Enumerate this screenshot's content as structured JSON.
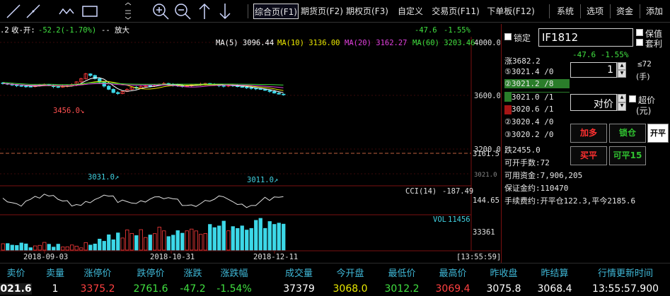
{
  "toolbar": {
    "tabs": [
      {
        "label": "综合页(F1)",
        "active": true
      },
      {
        "label": "期货页(F2)",
        "active": false
      },
      {
        "label": "期权页(F3)",
        "active": false
      },
      {
        "label": "自定义",
        "active": false
      },
      {
        "label": "交易页(F11)",
        "active": false
      },
      {
        "label": "下单板(F12)",
        "active": false
      },
      {
        "label": "系统",
        "active": false
      },
      {
        "label": "选项",
        "active": false
      },
      {
        "label": "资金",
        "active": false
      },
      {
        "label": "添加",
        "active": false
      }
    ]
  },
  "chart_header": {
    "left_prefix": ".2",
    "label": "收-开:",
    "change": "-52.2(-1.70%)",
    "zoom": "-- 放大",
    "right_change": "-47.6",
    "right_pct": "-1.55%"
  },
  "ma_legend": [
    {
      "label": "MA(5) 3096.44",
      "color": "#ffffff"
    },
    {
      "label": "MA(10) 3136.00",
      "color": "#e8e800"
    },
    {
      "label": "MA(20) 3162.27",
      "color": "#e040e0"
    },
    {
      "label": "MA(60) 3203.46",
      "color": "#40e040"
    }
  ],
  "chart_data": {
    "type": "candlestick",
    "price_axis_ticks": [
      "4000.0",
      "3600.0",
      "3200.0",
      "3021.0"
    ],
    "current_price_label": "3161.5",
    "annotations": [
      {
        "text": "3456.0↘",
        "color": "#ff5050"
      },
      {
        "text": "3031.0↗",
        "color": "#40d0e0"
      },
      {
        "text": "3011.0↗",
        "color": "#40d0e0"
      }
    ],
    "x_labels": [
      "2018-09-03",
      "2018-10-31",
      "2018-12-11"
    ],
    "cci": {
      "label": "CCI(14)",
      "value": "-187.49",
      "axis_tick": "144.65"
    },
    "volume": {
      "label": "VOL",
      "value": "11456",
      "axis_tick": "33361"
    },
    "time_box": "[13:55:59]"
  },
  "panel": {
    "lock_label": "锁定",
    "contract": "IF1812",
    "option_keep": "保值",
    "option_arb": "套利",
    "limit_up": "涨3682.2",
    "change_line": "-47.6  -1.55%",
    "asks": [
      {
        "label": "⑤3021.4 /0",
        "hl": ""
      },
      {
        "label": "②3021.2 /8",
        "hl": "green"
      },
      {
        "label": "①3021.0 /1",
        "hl": "green"
      }
    ],
    "bids": [
      {
        "label": "①3020.6 /1",
        "hl": "red"
      },
      {
        "label": "②3020.4 /0",
        "hl": ""
      },
      {
        "label": "③3020.2 /0",
        "hl": ""
      }
    ],
    "qty_value": "1",
    "qty_limit": "≤72",
    "qty_unit": "(手)",
    "price_value": "对价",
    "super_price": "超价",
    "super_unit": "(元)",
    "btn_buy": "加多",
    "btn_lock": "锁仓",
    "btn_open_close": "开平",
    "btn_sell": "买平",
    "btn_close15": "可平15",
    "limit_down": "跌2455.0",
    "open_lots": "可开手数:72",
    "available": "可用资金:7,906,205",
    "margin": "保证金约:110470",
    "fee": "手续费约:开平仓122.3,平今2185.6"
  },
  "quote": {
    "headers": [
      "卖价",
      "卖量",
      "涨停价",
      "跌停价",
      "涨跌",
      "涨跌幅",
      "成交量",
      "今开盘",
      "最低价",
      "最高价",
      "昨收盘",
      "昨结算",
      "行情更新时间"
    ],
    "values": [
      "021.6",
      "1",
      "3375.2",
      "2761.6",
      "-47.2",
      "-1.54%",
      "37379",
      "3068.0",
      "3012.2",
      "3069.4",
      "3075.8",
      "3068.4",
      "13:55:57.900"
    ],
    "colors": [
      "#ffffff",
      "#ffffff",
      "#ff4040",
      "#40e040",
      "#40e040",
      "#40e040",
      "#ffffff",
      "#e8e800",
      "#40e040",
      "#ff4040",
      "#ffffff",
      "#ffffff",
      "#ffffff"
    ]
  }
}
